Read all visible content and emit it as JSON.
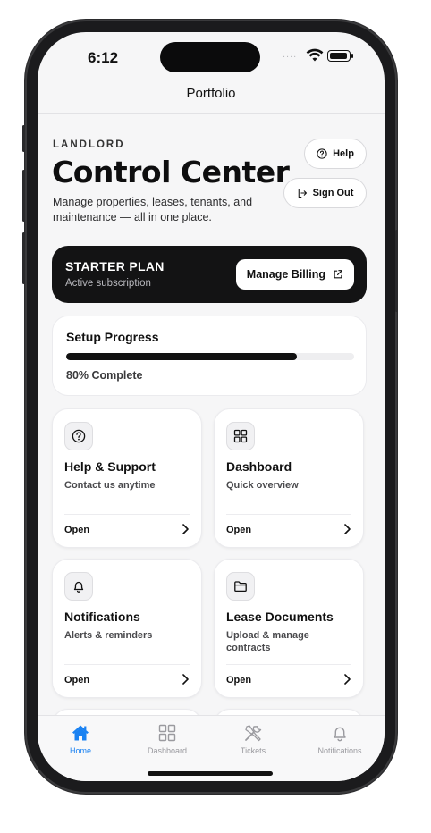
{
  "status_bar": {
    "time": "6:12",
    "signal": "....",
    "wifi_icon": "wifi-icon",
    "battery_icon": "battery-icon"
  },
  "nav": {
    "title": "Portfolio"
  },
  "header": {
    "eyebrow": "LANDLORD",
    "title": "Control Center",
    "subtitle": "Manage properties, leases, tenants, and maintenance — all in one place.",
    "help_label": "Help",
    "sign_out_label": "Sign Out"
  },
  "plan": {
    "name": "STARTER PLAN",
    "status": "Active subscription",
    "billing_label": "Manage Billing"
  },
  "progress": {
    "title": "Setup Progress",
    "percent": 80,
    "label": "80% Complete"
  },
  "tiles": [
    {
      "title": "Help & Support",
      "subtitle": "Contact us anytime",
      "action": "Open",
      "icon": "help-circle-icon"
    },
    {
      "title": "Dashboard",
      "subtitle": "Quick overview",
      "action": "Open",
      "icon": "grid-icon"
    },
    {
      "title": "Notifications",
      "subtitle": "Alerts & reminders",
      "action": "Open",
      "icon": "bell-icon"
    },
    {
      "title": "Lease Documents",
      "subtitle": "Upload & manage contracts",
      "action": "Open",
      "icon": "folder-icon"
    }
  ],
  "tabbar": {
    "items": [
      {
        "label": "Home",
        "icon": "house-icon",
        "active": true
      },
      {
        "label": "Dashboard",
        "icon": "grid-icon",
        "active": false
      },
      {
        "label": "Tickets",
        "icon": "tools-icon",
        "active": false
      },
      {
        "label": "Notifications",
        "icon": "bell-icon",
        "active": false
      }
    ]
  },
  "colors": {
    "accent": "#1a82f2",
    "dark": "#131314",
    "background": "#f6f6f7"
  }
}
